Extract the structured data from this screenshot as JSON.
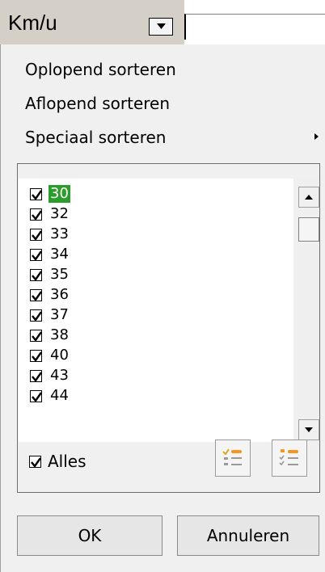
{
  "header": {
    "field_label": "Km/u",
    "search_value": ""
  },
  "menu": {
    "items": [
      "Oplopend sorteren",
      "Aflopend sorteren",
      "Speciaal sorteren"
    ]
  },
  "values_list": {
    "items": [
      {
        "label": "30",
        "checked": true,
        "selected": true
      },
      {
        "label": "32",
        "checked": true,
        "selected": false
      },
      {
        "label": "33",
        "checked": true,
        "selected": false
      },
      {
        "label": "34",
        "checked": true,
        "selected": false
      },
      {
        "label": "35",
        "checked": true,
        "selected": false
      },
      {
        "label": "36",
        "checked": true,
        "selected": false
      },
      {
        "label": "37",
        "checked": true,
        "selected": false
      },
      {
        "label": "38",
        "checked": true,
        "selected": false
      },
      {
        "label": "40",
        "checked": true,
        "selected": false
      },
      {
        "label": "43",
        "checked": true,
        "selected": false
      },
      {
        "label": "44",
        "checked": true,
        "selected": false
      }
    ]
  },
  "select_all": {
    "label": "Alles",
    "checked": true
  },
  "buttons": {
    "ok": "OK",
    "cancel": "Annuleren"
  },
  "colors": {
    "selection": "#2a9d2a",
    "panel_bg": "#f0f0f0",
    "header_bg": "#d4d0c8"
  },
  "icons": {
    "dropdown": "chevron-down-icon",
    "submenu": "chevron-right-icon",
    "check_all": "check-all-icon",
    "uncheck_all": "uncheck-all-icon"
  }
}
